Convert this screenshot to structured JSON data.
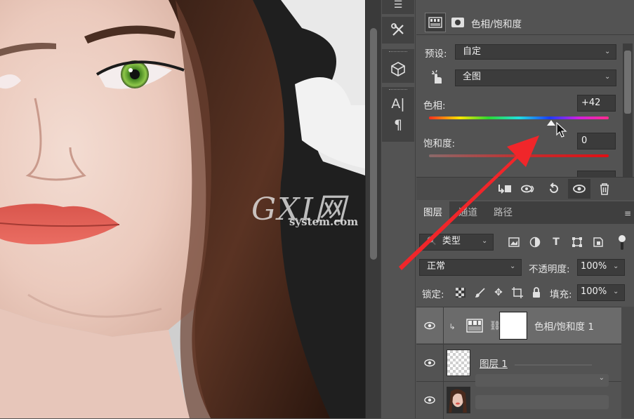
{
  "canvas": {
    "photo_subject": "portrait-face"
  },
  "watermark": {
    "letters": "GXI网",
    "url": "system.com"
  },
  "tools": {
    "icons": [
      "menu-icon",
      "crossed-tools-icon",
      "cube-3d-icon",
      "character-type-icon",
      "paragraph-icon"
    ]
  },
  "properties": {
    "title": "色相/饱和度",
    "preset_label": "预设:",
    "preset_value": "自定",
    "channel_value": "全图",
    "hue_label": "色相:",
    "hue_value": "+42",
    "hue_fraction": 0.68,
    "saturation_label": "饱和度:",
    "saturation_value": "0"
  },
  "layers_panel": {
    "tabs": [
      "图层",
      "通道",
      "路径"
    ],
    "filter_value": "类型",
    "blend_mode": "正常",
    "opacity_label": "不透明度:",
    "opacity_value": "100%",
    "lock_label": "锁定:",
    "fill_label": "填充:",
    "fill_value": "100%",
    "layers": [
      {
        "name": "色相/饱和度 1"
      },
      {
        "name": "图层 1"
      },
      {
        "name": ""
      }
    ]
  },
  "colors": {
    "panel_bg": "#535353",
    "arrow": "#f0262a",
    "slider_red": "#d40f12"
  }
}
